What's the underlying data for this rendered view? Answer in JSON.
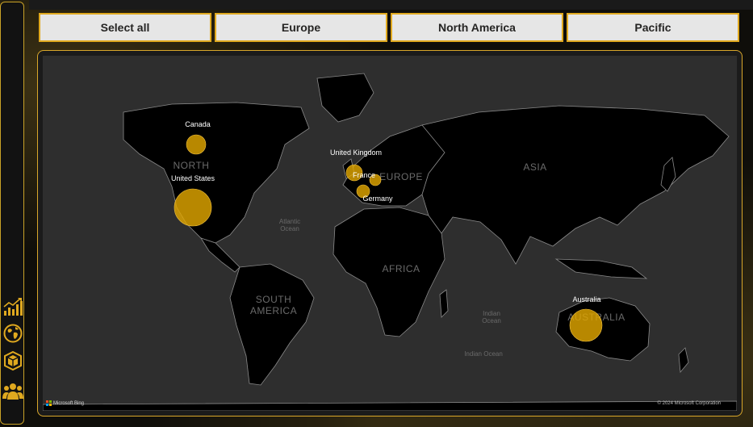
{
  "slicer": {
    "buttons": [
      {
        "label": "Select all"
      },
      {
        "label": "Europe"
      },
      {
        "label": "North America"
      },
      {
        "label": "Pacific"
      }
    ]
  },
  "sidebar": {
    "icons": [
      "bar-chart-growth-icon",
      "globe-icon",
      "package-icon",
      "team-icon"
    ]
  },
  "map": {
    "region_labels": {
      "north_america": "NORTH",
      "south_america_1": "SOUTH",
      "south_america_2": "AMERICA",
      "europe": "EUROPE",
      "africa": "AFRICA",
      "asia": "ASIA",
      "australia": "AUSTRALIA"
    },
    "ocean_labels": {
      "atlantic_1": "Atlantic",
      "atlantic_2": "Ocean",
      "indian_1": "Indian",
      "indian_2": "Ocean",
      "indian_3": "Indian Ocean"
    },
    "countries": [
      {
        "name": "Canada",
        "size_rank": 3
      },
      {
        "name": "United States",
        "size_rank": 1
      },
      {
        "name": "United Kingdom",
        "size_rank": 4
      },
      {
        "name": "France",
        "size_rank": 6
      },
      {
        "name": "Germany",
        "size_rank": 5
      },
      {
        "name": "Australia",
        "size_rank": 2
      }
    ],
    "attribution": "Microsoft Bing",
    "copyright": "© 2024 Microsoft Corporation"
  },
  "colors": {
    "accent": "#e0a91f",
    "bubble": "#e0a600",
    "land": "#000000",
    "water": "#2e2e2e"
  }
}
